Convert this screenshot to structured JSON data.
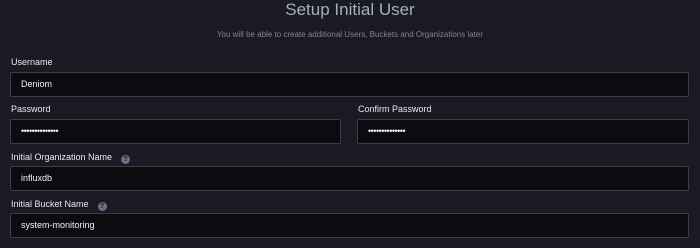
{
  "header": {
    "title": "Setup Initial User",
    "subtitle": "You will be able to create additional Users, Buckets and Organizations later"
  },
  "form": {
    "username": {
      "label": "Username",
      "value": "Deniom"
    },
    "password": {
      "label": "Password",
      "value": "••••••••••••••"
    },
    "confirm_password": {
      "label": "Confirm Password",
      "value": "••••••••••••••"
    },
    "org_name": {
      "label": "Initial Organization Name",
      "value": "influxdb",
      "help_icon": "question-circle-icon",
      "help_glyph": "?"
    },
    "bucket_name": {
      "label": "Initial Bucket Name",
      "value": "system-monitoring",
      "help_icon": "question-circle-icon",
      "help_glyph": "?"
    }
  },
  "colors": {
    "background": "#1a1a24",
    "input_background": "#0b0b10",
    "input_border": "#3b3c4c"
  }
}
